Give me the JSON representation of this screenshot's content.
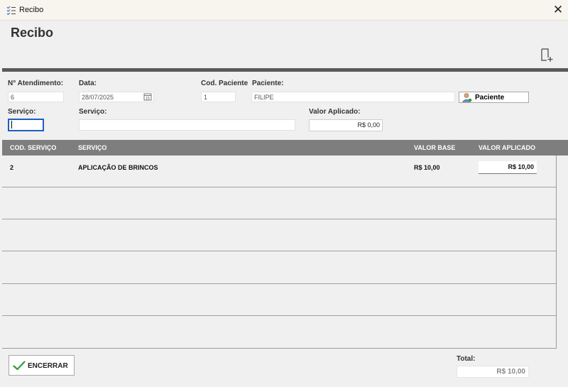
{
  "window": {
    "title": "Recibo",
    "close_glyph": "✕"
  },
  "page": {
    "title": "Recibo"
  },
  "form": {
    "atendimento_label": "N° Atendimento:",
    "atendimento_value": "6",
    "data_label": "Data:",
    "data_value": "28/07/2025",
    "cod_paciente_label": "Cod. Paciente",
    "cod_paciente_value": "1",
    "paciente_label": "Paciente:",
    "paciente_value": "FILIPE",
    "paciente_button": "Paciente",
    "servico_code_label": "Serviço:",
    "servico_code_value": "",
    "servico_label": "Serviço:",
    "servico_value": "",
    "valor_aplicado_label": "Valor Aplicado:",
    "valor_aplicado_value": "R$ 0,00"
  },
  "table": {
    "columns": [
      "COD. SERVIÇO",
      "SERVIÇO",
      "VALOR BASE",
      "VALOR APLICADO"
    ],
    "rows": [
      {
        "cod": "2",
        "servico": "APLICAÇÃO DE BRINCOS",
        "valor_base": "R$ 10,00",
        "valor_aplicado": "R$ 10,00"
      }
    ]
  },
  "footer": {
    "encerrar_label": "ENCERRAR",
    "total_label": "Total:",
    "total_value": "R$ 10,00"
  },
  "icons": {
    "app": "checklist-icon",
    "new_doc": "new-document-icon",
    "calendar": "calendar-icon",
    "patient": "person-icon",
    "check": "check-icon"
  },
  "colors": {
    "header_dark": "#5a5a5a",
    "grid_header": "#7e7e7e",
    "check_green": "#2e9d3a",
    "focus_border": "#1c5fbf"
  }
}
